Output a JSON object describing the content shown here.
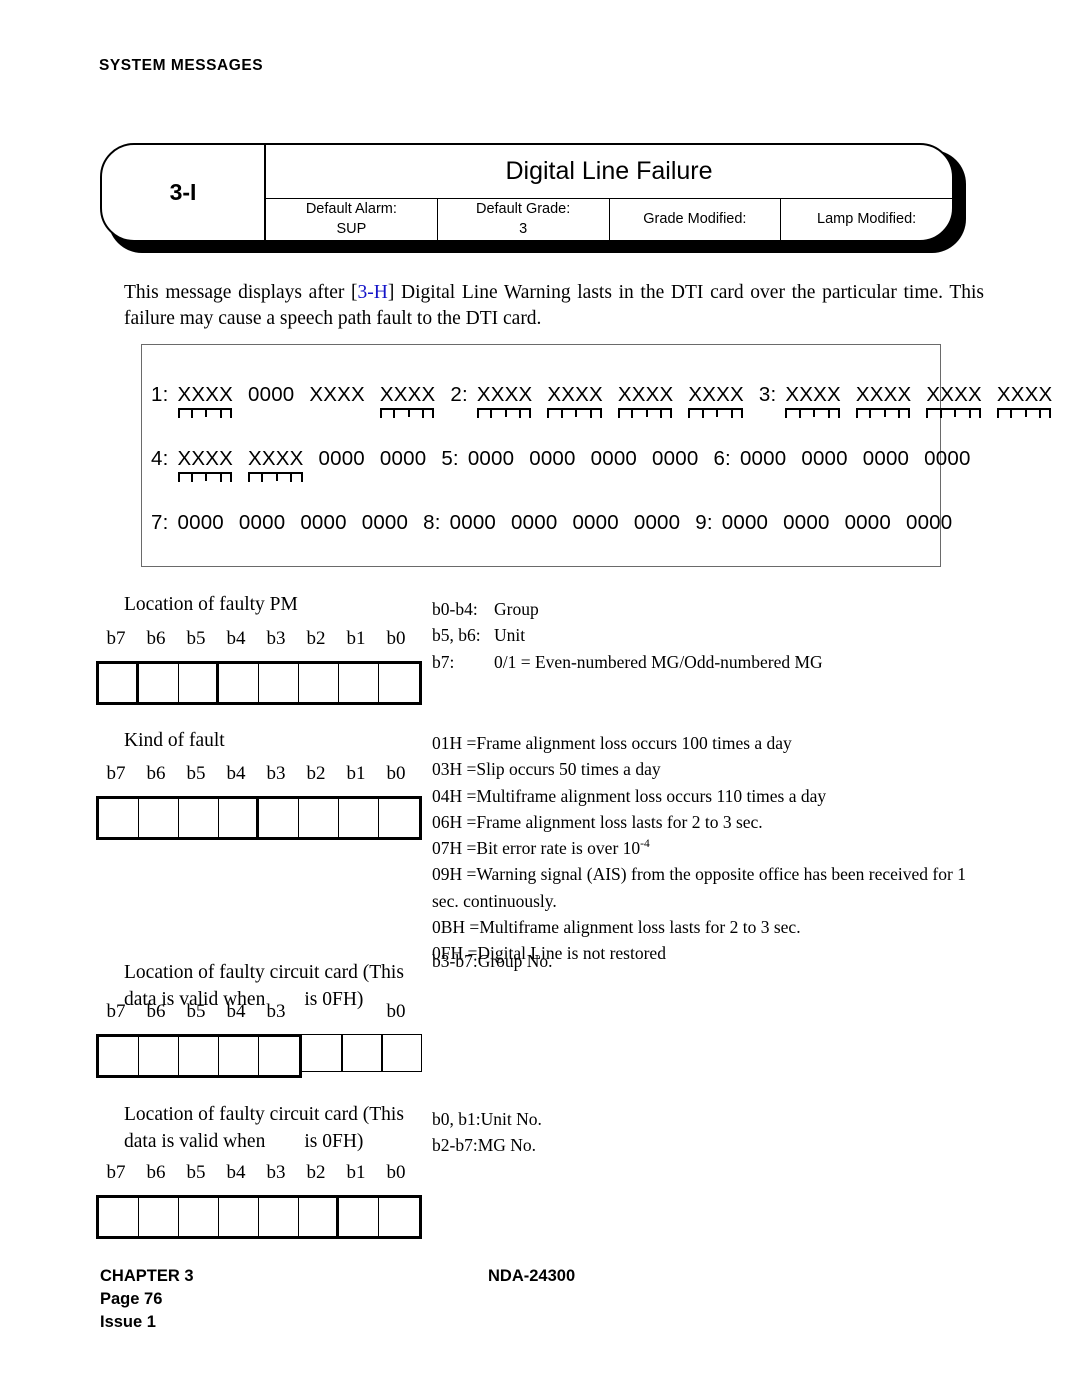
{
  "running_header": "SYSTEM MESSAGES",
  "plate": {
    "id": "3-I",
    "title": "Digital Line Failure",
    "cells": [
      {
        "label": "Default Alarm:",
        "value": "SUP"
      },
      {
        "label": "Default Grade:",
        "value": "3"
      },
      {
        "label": "Grade Modified:",
        "value": ""
      },
      {
        "label": "Lamp Modified:",
        "value": ""
      }
    ]
  },
  "intro": {
    "before": "This message displays after [",
    "link": "3-H",
    "after": "] Digital Line Warning lasts in the DTI card over the particular time. This failure may cause a speech path fault to the DTI card."
  },
  "data_frame": {
    "rows": [
      {
        "groups": [
          {
            "text": "1:",
            "index": true,
            "marked": false
          },
          {
            "text": "XXXX",
            "index": false,
            "marked": true
          },
          {
            "text": "0000",
            "index": false,
            "marked": false
          },
          {
            "text": "XXXX",
            "index": false,
            "marked": false
          },
          {
            "text": "XXXX",
            "index": false,
            "marked": true
          },
          {
            "text": "2:",
            "index": true,
            "marked": false
          },
          {
            "text": "XXXX",
            "index": false,
            "marked": true
          },
          {
            "text": "XXXX",
            "index": false,
            "marked": true
          },
          {
            "text": "XXXX",
            "index": false,
            "marked": true
          },
          {
            "text": "XXXX",
            "index": false,
            "marked": true
          },
          {
            "text": "3:",
            "index": true,
            "marked": false
          },
          {
            "text": "XXXX",
            "index": false,
            "marked": true
          },
          {
            "text": "XXXX",
            "index": false,
            "marked": true
          },
          {
            "text": "XXXX",
            "index": false,
            "marked": true
          },
          {
            "text": "XXXX",
            "index": false,
            "marked": true
          }
        ]
      },
      {
        "groups": [
          {
            "text": "4:",
            "index": true,
            "marked": false
          },
          {
            "text": "XXXX",
            "index": false,
            "marked": true
          },
          {
            "text": "XXXX",
            "index": false,
            "marked": true
          },
          {
            "text": "0000",
            "index": false,
            "marked": false
          },
          {
            "text": "0000",
            "index": false,
            "marked": false
          },
          {
            "text": "5:",
            "index": true,
            "marked": false
          },
          {
            "text": "0000",
            "index": false,
            "marked": false
          },
          {
            "text": "0000",
            "index": false,
            "marked": false
          },
          {
            "text": "0000",
            "index": false,
            "marked": false
          },
          {
            "text": "0000",
            "index": false,
            "marked": false
          },
          {
            "text": "6:",
            "index": true,
            "marked": false
          },
          {
            "text": "0000",
            "index": false,
            "marked": false
          },
          {
            "text": "0000",
            "index": false,
            "marked": false
          },
          {
            "text": "0000",
            "index": false,
            "marked": false
          },
          {
            "text": "0000",
            "index": false,
            "marked": false
          }
        ]
      },
      {
        "groups": [
          {
            "text": "7:",
            "index": true,
            "marked": false
          },
          {
            "text": "0000",
            "index": false,
            "marked": false
          },
          {
            "text": "0000",
            "index": false,
            "marked": false
          },
          {
            "text": "0000",
            "index": false,
            "marked": false
          },
          {
            "text": "0000",
            "index": false,
            "marked": false
          },
          {
            "text": "8:",
            "index": true,
            "marked": false
          },
          {
            "text": "0000",
            "index": false,
            "marked": false
          },
          {
            "text": "0000",
            "index": false,
            "marked": false
          },
          {
            "text": "0000",
            "index": false,
            "marked": false
          },
          {
            "text": "0000",
            "index": false,
            "marked": false
          },
          {
            "text": "9:",
            "index": true,
            "marked": false
          },
          {
            "text": "0000",
            "index": false,
            "marked": false
          },
          {
            "text": "0000",
            "index": false,
            "marked": false
          },
          {
            "text": "0000",
            "index": false,
            "marked": false
          },
          {
            "text": "0000",
            "index": false,
            "marked": false
          }
        ]
      }
    ]
  },
  "sections": [
    {
      "caption_line1": "Location of faulty PM",
      "caption_line2": "",
      "bit_labels": [
        "b7",
        "b6",
        "b5",
        "b4",
        "b3",
        "b2",
        "b1",
        "b0"
      ],
      "annotations": [
        {
          "key": "b0-b4:",
          "text": "Group"
        },
        {
          "key": "b5, b6:",
          "text": "Unit"
        },
        {
          "key": "b7:",
          "text": "0/1 = Even-numbered MG/Odd-numbered MG"
        }
      ]
    },
    {
      "caption_line1": "Kind of fault",
      "caption_line2": "",
      "bit_labels": [
        "b7",
        "b6",
        "b5",
        "b4",
        "b3",
        "b2",
        "b1",
        "b0"
      ],
      "annotations": [
        {
          "key": "01H =",
          "text": "Frame alignment loss occurs 100 times a day"
        },
        {
          "key": "03H =",
          "text": "Slip occurs 50 times a day"
        },
        {
          "key": "04H =",
          "text": "Multiframe alignment loss occurs 110 times a day"
        },
        {
          "key": "06H =",
          "text": "Frame alignment loss lasts for 2 to 3 sec."
        },
        {
          "key": "07H =",
          "text": "Bit error rate is over 10",
          "sup": "-4"
        },
        {
          "key": "09H =",
          "text": "Warning signal (AIS) from the opposite office has been received for 1 sec. continuously."
        },
        {
          "key": "0BH =",
          "text": "Multiframe alignment loss lasts for 2 to 3 sec."
        },
        {
          "key": "0FH =",
          "text": "Digital Line is not restored"
        }
      ]
    },
    {
      "caption_line1": "Location of faulty circuit card (This",
      "caption_line2": "data is valid when        is 0FH)",
      "bit_labels": [
        "b7",
        "b6",
        "b5",
        "b4",
        "b3",
        "",
        "",
        "b0"
      ],
      "annotations": [
        {
          "key": "b3-b7:",
          "text": "Group No."
        }
      ]
    },
    {
      "caption_line1": "Location of faulty circuit card (This",
      "caption_line2": "data is valid when        is 0FH)",
      "bit_labels": [
        "b7",
        "b6",
        "b5",
        "b4",
        "b3",
        "b2",
        "b1",
        "b0"
      ],
      "annotations": [
        {
          "key": "b0, b1:",
          "text": "Unit No."
        },
        {
          "key": "b2-b7:",
          "text": "MG No."
        }
      ]
    }
  ],
  "footer": {
    "chapter": "CHAPTER 3",
    "page": "Page 76",
    "issue": "Issue 1",
    "doc_id": "NDA-24300"
  }
}
